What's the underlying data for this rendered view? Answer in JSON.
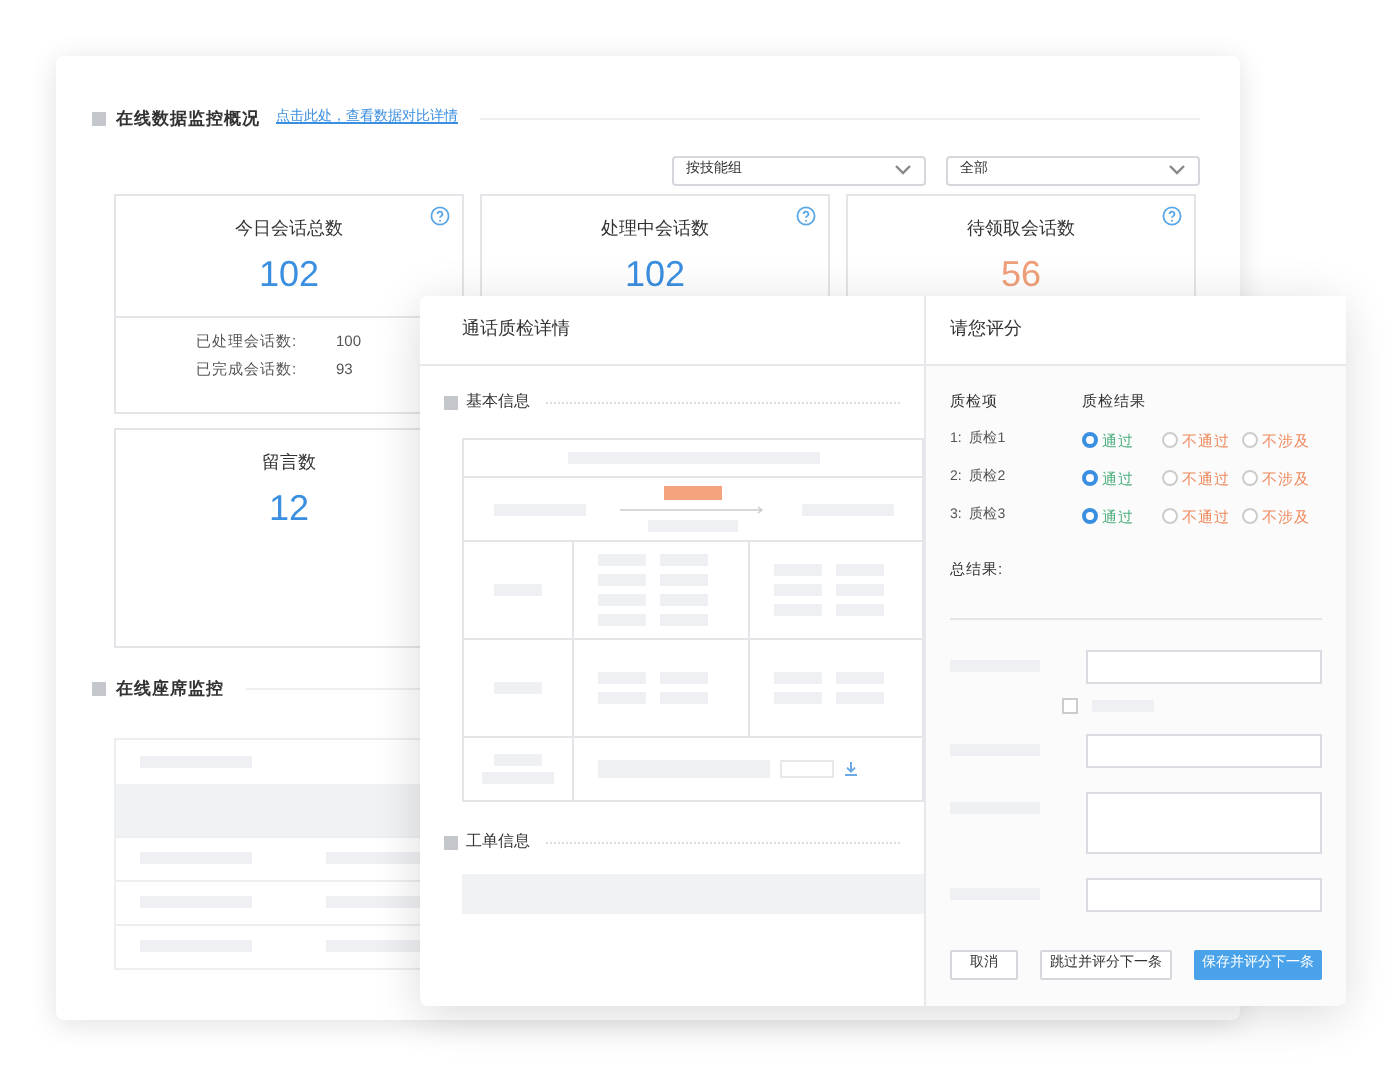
{
  "overview": {
    "title": "在线数据监控概况",
    "link": "点击此处，查看数据对比详情",
    "filters": [
      {
        "value": "按技能组"
      },
      {
        "value": "全部"
      }
    ],
    "stat_cards": [
      {
        "label": "今日会话总数",
        "value": "102",
        "color": "#3b8fe0",
        "help": true,
        "breakdown": [
          {
            "label": "已处理会话数:",
            "value": "100"
          },
          {
            "label": "已完成会话数:",
            "value": "93"
          }
        ]
      },
      {
        "label": "处理中会话数",
        "value": "102",
        "color": "#3b8fe0",
        "help": true
      },
      {
        "label": "待领取会话数",
        "value": "56",
        "color": "#f0a07a",
        "help": true
      },
      {
        "label": "留言数",
        "value": "12",
        "color": "#3b8fe0"
      }
    ]
  },
  "seats": {
    "title": "在线座席监控"
  },
  "dialog": {
    "title": "通话质检详情",
    "sections": [
      {
        "title": "基本信息"
      },
      {
        "title": "工单信息"
      }
    ]
  },
  "rating": {
    "title": "请您评分",
    "columns": [
      "质检项",
      "质检结果"
    ],
    "items": [
      {
        "label": "1:  质检1",
        "options": [
          {
            "label": "通过",
            "kind": "pass",
            "selected": true
          },
          {
            "label": "不通过",
            "kind": "fail",
            "selected": false
          },
          {
            "label": "不涉及",
            "kind": "na",
            "selected": false
          }
        ]
      },
      {
        "label": "2:  质检2",
        "options": [
          {
            "label": "通过",
            "kind": "pass",
            "selected": true
          },
          {
            "label": "不通过",
            "kind": "fail",
            "selected": false
          },
          {
            "label": "不涉及",
            "kind": "na",
            "selected": false
          }
        ]
      },
      {
        "label": "3:  质检3",
        "options": [
          {
            "label": "通过",
            "kind": "pass",
            "selected": true
          },
          {
            "label": "不通过",
            "kind": "fail",
            "selected": false
          },
          {
            "label": "不涉及",
            "kind": "na",
            "selected": false
          }
        ]
      }
    ],
    "summary_label": "总结果:",
    "option_checked": false,
    "buttons": [
      {
        "label": "取消",
        "kind": "default"
      },
      {
        "label": "跳过并评分下一条",
        "kind": "default"
      },
      {
        "label": "保存并评分下一条",
        "kind": "primary"
      }
    ]
  }
}
